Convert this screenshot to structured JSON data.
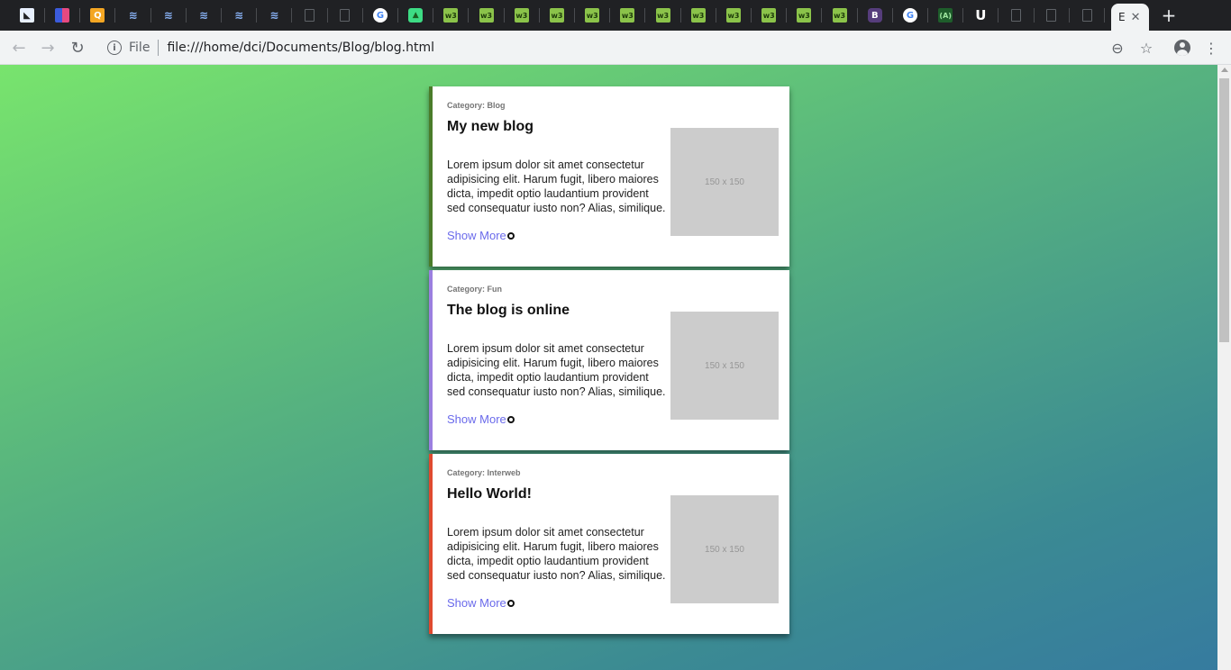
{
  "browser": {
    "tabs": [
      {
        "icon": "bird-favicon-icon",
        "glyph": "◣"
      },
      {
        "icon": "flag-favicon-icon",
        "glyph": ""
      },
      {
        "icon": "q-favicon-icon",
        "glyph": "Q"
      },
      {
        "icon": "wifi-favicon-icon",
        "glyph": "≋"
      },
      {
        "icon": "wifi-favicon-icon",
        "glyph": "≋"
      },
      {
        "icon": "wifi-favicon-icon",
        "glyph": "≋"
      },
      {
        "icon": "wifi-favicon-icon",
        "glyph": "≋"
      },
      {
        "icon": "wifi-favicon-icon",
        "glyph": "≋"
      },
      {
        "icon": "page-favicon-icon",
        "glyph": ""
      },
      {
        "icon": "page-favicon-icon",
        "glyph": ""
      },
      {
        "icon": "google-favicon-icon",
        "glyph": "G"
      },
      {
        "icon": "android-favicon-icon",
        "glyph": "▲"
      },
      {
        "icon": "w3-favicon-icon",
        "glyph": "w3"
      },
      {
        "icon": "w3-favicon-icon",
        "glyph": "w3"
      },
      {
        "icon": "w3-favicon-icon",
        "glyph": "w3"
      },
      {
        "icon": "w3-favicon-icon",
        "glyph": "w3"
      },
      {
        "icon": "w3-favicon-icon",
        "glyph": "w3"
      },
      {
        "icon": "w3-favicon-icon",
        "glyph": "w3"
      },
      {
        "icon": "w3-favicon-icon",
        "glyph": "w3"
      },
      {
        "icon": "w3-favicon-icon",
        "glyph": "w3"
      },
      {
        "icon": "w3-favicon-icon",
        "glyph": "w3"
      },
      {
        "icon": "w3-favicon-icon",
        "glyph": "w3"
      },
      {
        "icon": "w3-favicon-icon",
        "glyph": "w3"
      },
      {
        "icon": "w3-favicon-icon",
        "glyph": "w3"
      },
      {
        "icon": "bootstrap-favicon-icon",
        "glyph": "B"
      },
      {
        "icon": "google-favicon-icon",
        "glyph": "G"
      },
      {
        "icon": "angular-favicon-icon",
        "glyph": "(A)"
      },
      {
        "icon": "u-favicon-icon",
        "glyph": "U"
      },
      {
        "icon": "page-favicon-icon",
        "glyph": ""
      },
      {
        "icon": "page-favicon-icon",
        "glyph": ""
      },
      {
        "icon": "page-favicon-icon",
        "glyph": ""
      }
    ],
    "active_tab_label": "E",
    "close_glyph": "✕",
    "new_tab_glyph": "+",
    "back_glyph": "←",
    "forward_glyph": "→",
    "reload_glyph": "↻",
    "info_glyph": "i",
    "scheme_label": "File",
    "url": "file:///home/dci/Documents/Blog/blog.html",
    "zoom_glyph": "⊖",
    "star_glyph": "☆",
    "menu_glyph": "⋮"
  },
  "posts": [
    {
      "category": "Category: Blog",
      "title": "My new blog",
      "body": "Lorem ipsum dolor sit amet consectetur adipisicing elit. Harum fugit, libero maiores dicta, impedit optio laudantium provident sed consequatur iusto non? Alias, similique.",
      "link": "Show More",
      "image_placeholder": "150 x 150",
      "accent": "#4a7c2a"
    },
    {
      "category": "Category: Fun",
      "title": "The blog is online",
      "body": "Lorem ipsum dolor sit amet consectetur adipisicing elit. Harum fugit, libero maiores dicta, impedit optio laudantium provident sed consequatur iusto non? Alias, similique.",
      "link": "Show More",
      "image_placeholder": "150 x 150",
      "accent": "#9b7fe0"
    },
    {
      "category": "Category: Interweb",
      "title": "Hello World!",
      "body": "Lorem ipsum dolor sit amet consectetur adipisicing elit. Harum fugit, libero maiores dicta, impedit optio laudantium provident sed consequatur iusto non? Alias, similique.",
      "link": "Show More",
      "image_placeholder": "150 x 150",
      "accent": "#e04a2f"
    }
  ]
}
